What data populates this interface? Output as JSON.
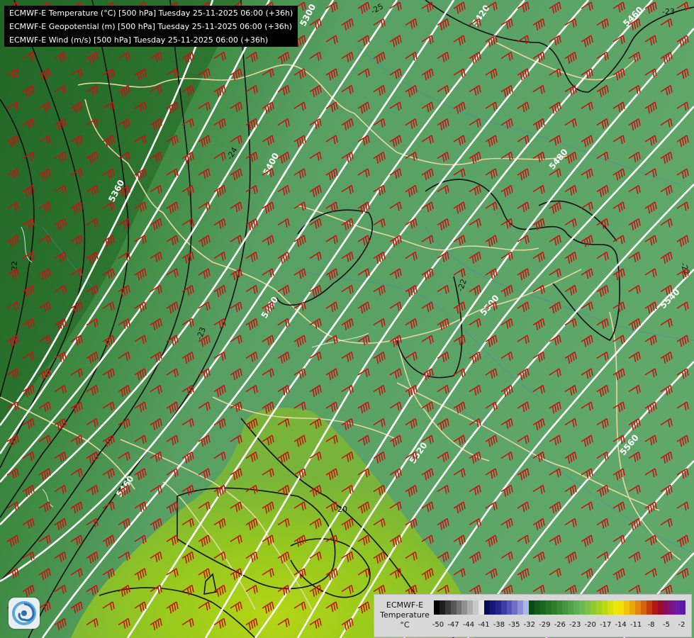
{
  "header": {
    "lines": [
      "ECMWF-E Temperature (°C) [500 hPa] Tuesday 25-11-2025 06:00 (+36h)",
      "ECMWF-E Geopotential (m) [500 hPa] Tuesday 25-11-2025 06:00 (+36h)",
      "ECMWF-E Wind (m/s) [500 hPa] Tuesday 25-11-2025 06:00 (+36h)"
    ]
  },
  "legend": {
    "model": "ECMWF-E",
    "variable": "Temperature",
    "unit": "°C",
    "ticks": [
      "-50",
      "-47",
      "-44",
      "-41",
      "-38",
      "-35",
      "-32",
      "-29",
      "-26",
      "-23",
      "-20",
      "-17",
      "-14",
      "-11",
      "-8",
      "-5",
      "-2"
    ],
    "colors": [
      "#000000",
      "#1e1e1e",
      "#3a3a3a",
      "#575757",
      "#737373",
      "#909090",
      "#acacac",
      "#c8c8c8",
      "#e6e6e6",
      "#0a0a5a",
      "#17177a",
      "#25258f",
      "#3c3ca6",
      "#5555bb",
      "#6f6fc8",
      "#8f8fd6",
      "#a9b8e8",
      "#0a4d14",
      "#145a1a",
      "#1d6620",
      "#267226",
      "#2f7e2d",
      "#3a8a35",
      "#46963f",
      "#52a24a",
      "#5fae55",
      "#6cba55",
      "#7dc246",
      "#8fca2f",
      "#a4d11c",
      "#bcd812",
      "#d5e00c",
      "#eee80a",
      "#f5df08",
      "#f0c409",
      "#e9a70b",
      "#e0850d",
      "#d4620e",
      "#c43e10",
      "#b01a12",
      "#9c0a2a",
      "#8a0e5e",
      "#7c1488",
      "#6e1aa8",
      "#5a1aa8"
    ],
    "tick_values": [
      -50,
      -47,
      -44,
      -41,
      -38,
      -35,
      -32,
      -29,
      -26,
      -23,
      -20,
      -17,
      -14,
      -11,
      -8,
      -5,
      -2
    ]
  },
  "map": {
    "geopotential_labels": [
      "5300",
      "5360",
      "5400",
      "5420",
      "5460",
      "5480",
      "5460",
      "5500",
      "5520",
      "5540",
      "5560",
      "5480",
      "5460",
      "5400"
    ],
    "temperature_labels": [
      "-25",
      "-23",
      "-24",
      "-22",
      "-23",
      "-22",
      "-22",
      "-20"
    ],
    "colors": {
      "cold": "#246b28",
      "mid": "#4e9a58",
      "base": "#5ea86a",
      "warm": "#7fbf2b",
      "warmest": "#a6cf18",
      "barb": "#c41414"
    }
  }
}
